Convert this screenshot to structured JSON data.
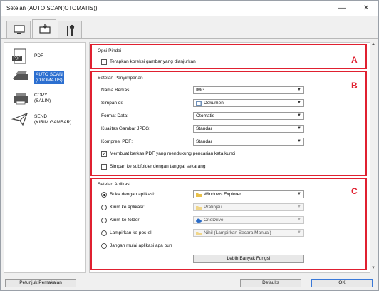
{
  "window": {
    "title": "Setelan (AUTO SCAN(OTOMATIS))",
    "minimize_glyph": "—",
    "close_glyph": "✕"
  },
  "tabs": [
    {
      "icon": "computer-scan-icon",
      "active": false
    },
    {
      "icon": "computer-arrow-icon",
      "active": true
    },
    {
      "icon": "tools-icon",
      "active": false
    }
  ],
  "sidebar": {
    "items": [
      {
        "label": "PDF",
        "icon": "pdf-icon",
        "selected": false
      },
      {
        "label": "AUTO SCAN (OTOMATIS)",
        "label_line1": "AUTO SCAN",
        "label_line2": "(OTOMATIS)",
        "icon": "auto-scan-icon",
        "selected": true
      },
      {
        "label": "COPY (SALIN)",
        "label_line1": "COPY",
        "label_line2": "(SALIN)",
        "icon": "copy-icon",
        "selected": false
      },
      {
        "label": "SEND (KIRIM GAMBAR)",
        "label_line1": "SEND",
        "label_line2": "(KIRIM GAMBAR)",
        "icon": "send-icon",
        "selected": false
      }
    ]
  },
  "sections": {
    "scan_options": {
      "letter": "A",
      "title": "Opsi Pindai",
      "apply_correction_label": "Terapkan koreksi gambar yang dianjurkan",
      "apply_correction_checked": false
    },
    "save_settings": {
      "letter": "B",
      "title": "Setelan Penyimpanan",
      "file_name_label": "Nama Berkas:",
      "file_name_value": "IMG",
      "save_in_label": "Simpan di:",
      "save_in_value": "Dokumen",
      "data_format_label": "Format Data:",
      "data_format_value": "Otomatis",
      "jpeg_quality_label": "Kualitas Gambar JPEG:",
      "jpeg_quality_value": "Standar",
      "pdf_compression_label": "Kompresi PDF:",
      "pdf_compression_value": "Standar",
      "searchable_pdf_label": "Membuat berkas PDF yang mendukung pencarian kata kunci",
      "searchable_pdf_checked": true,
      "subfolder_label": "Simpan ke subfolder dengan tanggal sekarang",
      "subfolder_checked": false
    },
    "app_settings": {
      "letter": "C",
      "title": "Setelan Aplikasi",
      "open_with_label": "Buka dengan aplikasi:",
      "open_with_value": "Windows Explorer",
      "send_to_app_label": "Kirim ke aplikasi:",
      "send_to_app_value": "Pratinjau",
      "send_to_folder_label": "Kirim ke folder:",
      "send_to_folder_value": "OneDrive",
      "attach_email_label": "Lampirkan ke pos-el:",
      "attach_email_value": "Nihil (Lampirkan Secara Manual)",
      "do_not_start_label": "Jangan mulai aplikasi apa pun",
      "selected_option": "open_with",
      "more_functions_label": "Lebih Banyak Fungsi"
    }
  },
  "footer": {
    "instructions_label": "Petunjuk Pemakaian",
    "defaults_label": "Defaults",
    "ok_label": "OK"
  },
  "colors": {
    "highlight_box": "#e02030",
    "selection": "#2c6fd0"
  }
}
